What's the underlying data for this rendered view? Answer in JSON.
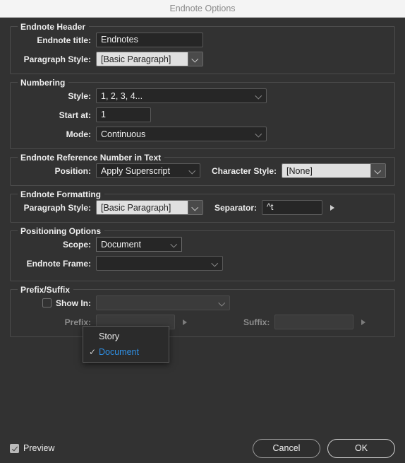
{
  "window": {
    "title": "Endnote Options"
  },
  "sections": {
    "header": {
      "title": "Endnote Header",
      "title_label": "Endnote title:",
      "title_value": "Endnotes",
      "paragraph_style_label": "Paragraph Style:",
      "paragraph_style_value": "[Basic Paragraph]"
    },
    "numbering": {
      "title": "Numbering",
      "style_label": "Style:",
      "style_value": "1, 2, 3, 4...",
      "start_at_label": "Start at:",
      "start_at_value": "1",
      "mode_label": "Mode:",
      "mode_value": "Continuous"
    },
    "reference": {
      "title": "Endnote Reference Number in Text",
      "position_label": "Position:",
      "position_value": "Apply Superscript",
      "character_style_label": "Character Style:",
      "character_style_value": "[None]"
    },
    "formatting": {
      "title": "Endnote Formatting",
      "paragraph_style_label": "Paragraph Style:",
      "paragraph_style_value": "[Basic Paragraph]",
      "separator_label": "Separator:",
      "separator_value": "^t"
    },
    "positioning": {
      "title": "Positioning Options",
      "scope_label": "Scope:",
      "scope_value": "Document",
      "scope_options": [
        "Story",
        "Document"
      ],
      "scope_selected": "Document",
      "endnote_frame_label": "Endnote Frame:",
      "endnote_frame_value": ""
    },
    "prefix_suffix": {
      "title": "Prefix/Suffix",
      "show_in_label": "Show In:",
      "show_in_value": "",
      "show_in_checked": false,
      "prefix_label": "Prefix:",
      "prefix_value": "",
      "suffix_label": "Suffix:",
      "suffix_value": ""
    }
  },
  "footer": {
    "preview_label": "Preview",
    "preview_checked": true,
    "cancel_label": "Cancel",
    "ok_label": "OK"
  },
  "colors": {
    "dialog_bg": "#323232",
    "titlebar_bg": "#f4f4f4",
    "accent_blue": "#2f8fe3",
    "field_dark": "#262626",
    "field_light": "#e0e0e0"
  }
}
